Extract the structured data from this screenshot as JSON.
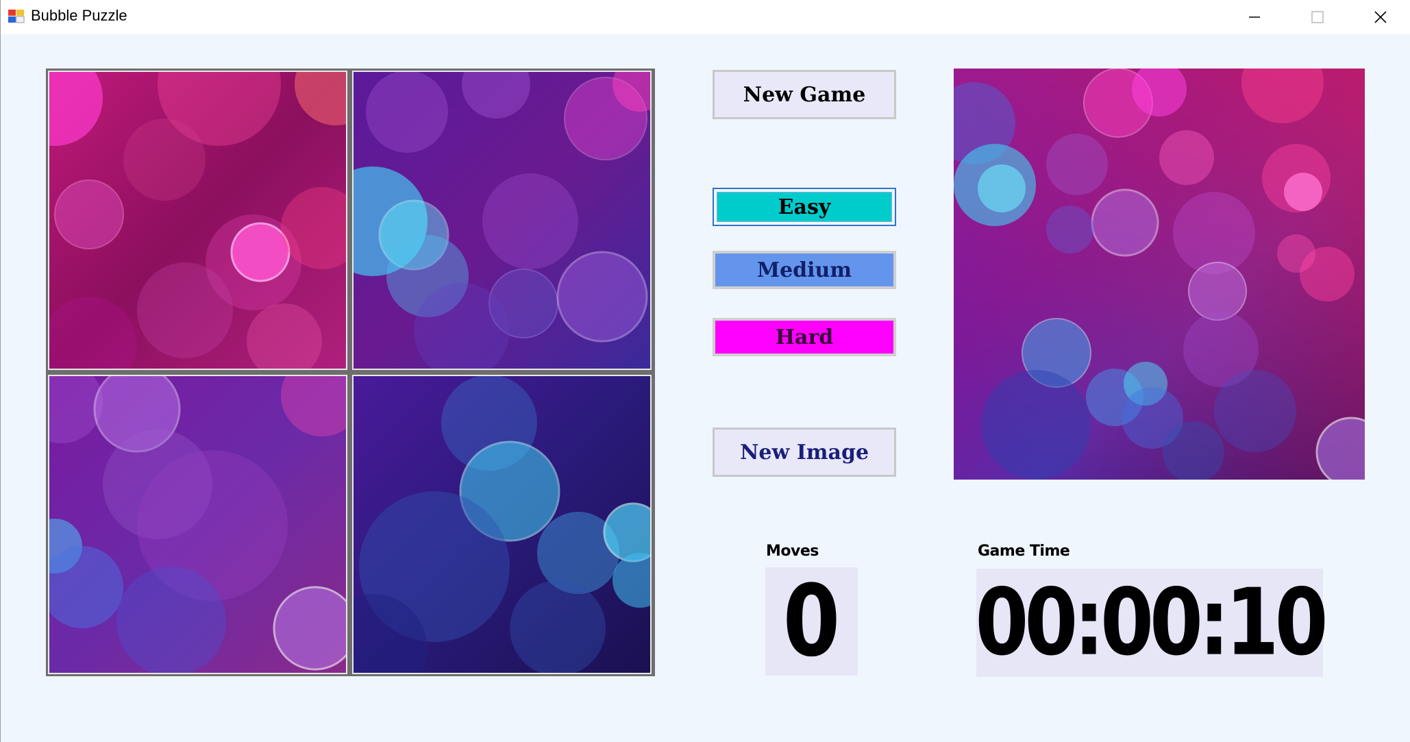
{
  "window": {
    "title": "Bubble Puzzle",
    "icons": {
      "app": "app-icon",
      "minimize": "minimize-icon",
      "maximize": "maximize-icon",
      "close": "close-icon"
    }
  },
  "buttons": {
    "new_game": "New Game",
    "easy": "Easy",
    "medium": "Medium",
    "hard": "Hard",
    "new_image": "New Image"
  },
  "level_colors": {
    "easy": "#00cccc",
    "medium": "#6495ed",
    "hard": "#ff00ff"
  },
  "stats": {
    "moves_label": "Moves",
    "moves_value": "0",
    "time_label": "Game Time",
    "time_value": "00:00:10"
  },
  "puzzle": {
    "grid": "2x2",
    "tiles": 4
  }
}
